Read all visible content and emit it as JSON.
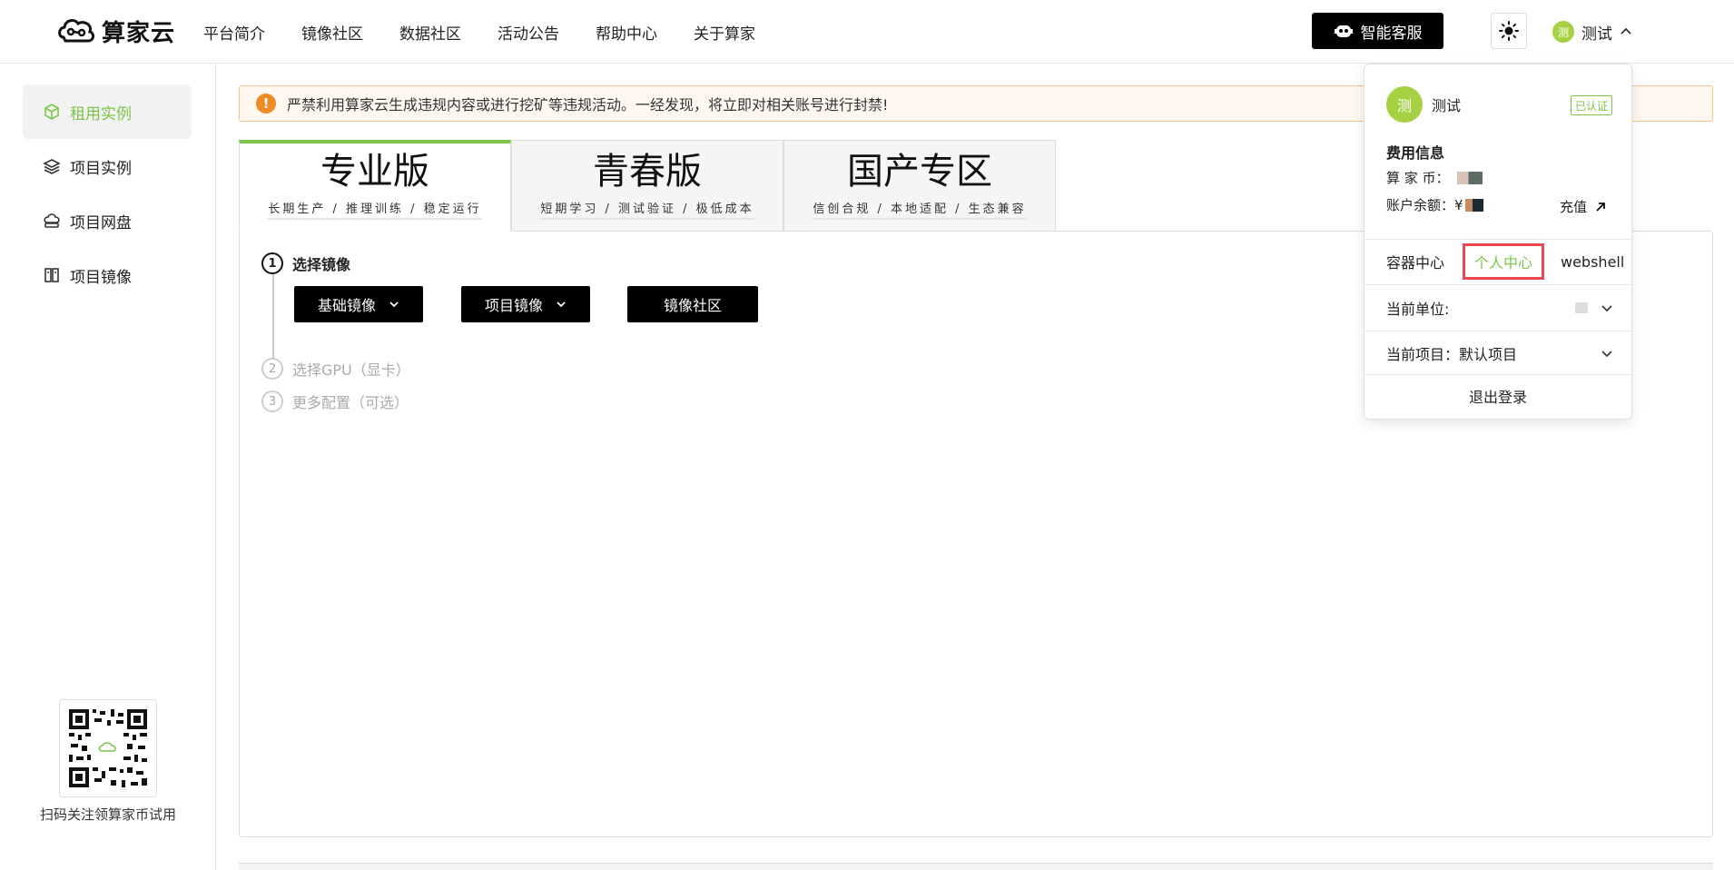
{
  "header": {
    "logo_text": "算家云",
    "nav": [
      "平台简介",
      "镜像社区",
      "数据社区",
      "活动公告",
      "帮助中心",
      "关于算家"
    ],
    "ai_service_label": "智能客服",
    "user_name": "测试",
    "avatar_char": "测"
  },
  "sidebar": {
    "items": [
      {
        "label": "租用实例",
        "icon": "cube-icon",
        "active": true
      },
      {
        "label": "项目实例",
        "icon": "layers-icon",
        "active": false
      },
      {
        "label": "项目网盘",
        "icon": "cloud-drive-icon",
        "active": false
      },
      {
        "label": "项目镜像",
        "icon": "image-files-icon",
        "active": false
      }
    ],
    "qr_caption": "扫码关注领算家币试用"
  },
  "alert": {
    "text": "严禁利用算家云生成违规内容或进行挖矿等违规活动。一经发现，将立即对相关账号进行封禁!"
  },
  "tabs": [
    {
      "title": "专业版",
      "subtitle": "长期生产 / 推理训练 / 稳定运行",
      "active": true
    },
    {
      "title": "青春版",
      "subtitle": "短期学习 / 测试验证 / 极低成本",
      "active": false
    },
    {
      "title": "国产专区",
      "subtitle": "信创合规 / 本地适配 / 生态兼容",
      "active": false
    }
  ],
  "steps": [
    {
      "num": "1",
      "label": "选择镜像",
      "active": true
    },
    {
      "num": "2",
      "label": "选择GPU（显卡）",
      "active": false
    },
    {
      "num": "3",
      "label": "更多配置（可选）",
      "active": false
    }
  ],
  "image_buttons": {
    "base": "基础镜像",
    "project": "项目镜像",
    "community": "镜像社区"
  },
  "dropdown": {
    "name": "测试",
    "avatar_char": "测",
    "verified": "已认证",
    "fee_title": "费用信息",
    "coin_label": "算 家 币：",
    "balance_label": "账户余额：",
    "balance_prefix": "¥",
    "recharge": "充值",
    "link_container": "容器中心",
    "link_personal": "个人中心",
    "link_webshell": "webshell",
    "unit_label": "当前单位:",
    "project_label": "当前项目：默认项目",
    "logout": "退出登录"
  },
  "colors": {
    "accent": "#7dc44a",
    "highlight_border": "#e8484e",
    "alert_icon": "#f08a24"
  }
}
